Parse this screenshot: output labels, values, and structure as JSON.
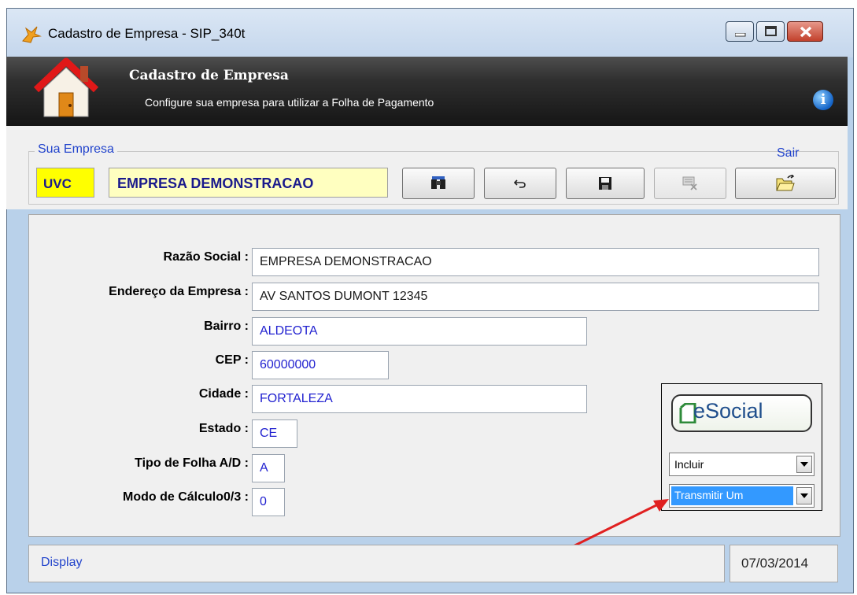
{
  "window": {
    "title": "Cadastro de Empresa  - SIP_340t"
  },
  "header": {
    "title": "Cadastro de Empresa",
    "subtitle": "Configure sua empresa para utilizar a Folha de Pagamento"
  },
  "company_group": {
    "legend": "Sua Empresa",
    "code": "UVC",
    "name": "EMPRESA DEMONSTRACAO",
    "exit_label": "Sair"
  },
  "form": {
    "fields": [
      {
        "label": "Razão Social :",
        "value": "EMPRESA DEMONSTRACAO"
      },
      {
        "label": "Endereço da Empresa :",
        "value": "AV SANTOS DUMONT 12345"
      },
      {
        "label": "Bairro :",
        "value": "ALDEOTA"
      },
      {
        "label": "CEP :",
        "value": "60000000"
      },
      {
        "label": "Cidade :",
        "value": "FORTALEZA"
      },
      {
        "label": "Estado :",
        "value": "CE"
      },
      {
        "label": "Tipo de Folha A/D :",
        "value": "A"
      },
      {
        "label": "Modo de Cálculo0/3 :",
        "value": "0"
      }
    ]
  },
  "esocial": {
    "logo_text": "eSocial",
    "action": "Incluir",
    "mode": "Transmitir Um"
  },
  "status": {
    "mode": "Display",
    "date": "07/03/2014"
  },
  "colors": {
    "accent_blue": "#2244cc",
    "code_bg": "#ffff00",
    "name_bg": "#ffffc0",
    "annotation_arrow": "#e02020"
  }
}
